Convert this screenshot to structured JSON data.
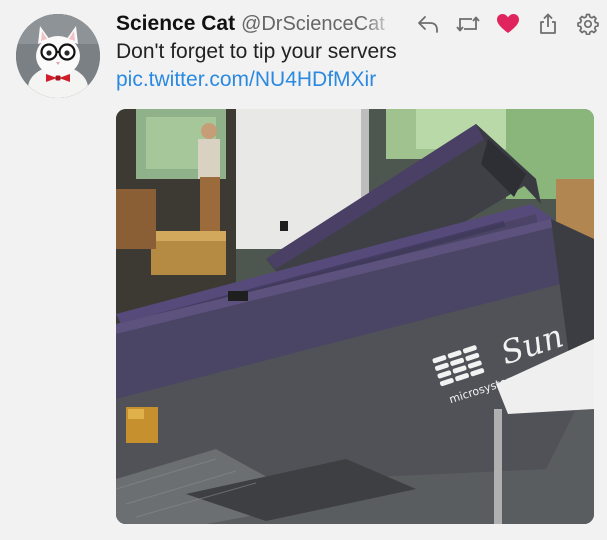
{
  "tweet": {
    "display_name": "Science Cat",
    "handle": "@DrScienceCat",
    "text": "Don't forget to tip your servers",
    "link": "pic.twitter.com/NU4HDfMXir",
    "liked": true
  },
  "actions": [
    {
      "name": "reply-icon"
    },
    {
      "name": "retweet-icon"
    },
    {
      "name": "like-icon"
    },
    {
      "name": "share-icon"
    },
    {
      "name": "settings-icon"
    }
  ],
  "media": {
    "brand_text": "Sun",
    "subtitle_text": "microsystems"
  },
  "colors": {
    "like_active": "#e0245e",
    "link": "#2b8ae0",
    "icon_gray": "#6e6e6e"
  }
}
